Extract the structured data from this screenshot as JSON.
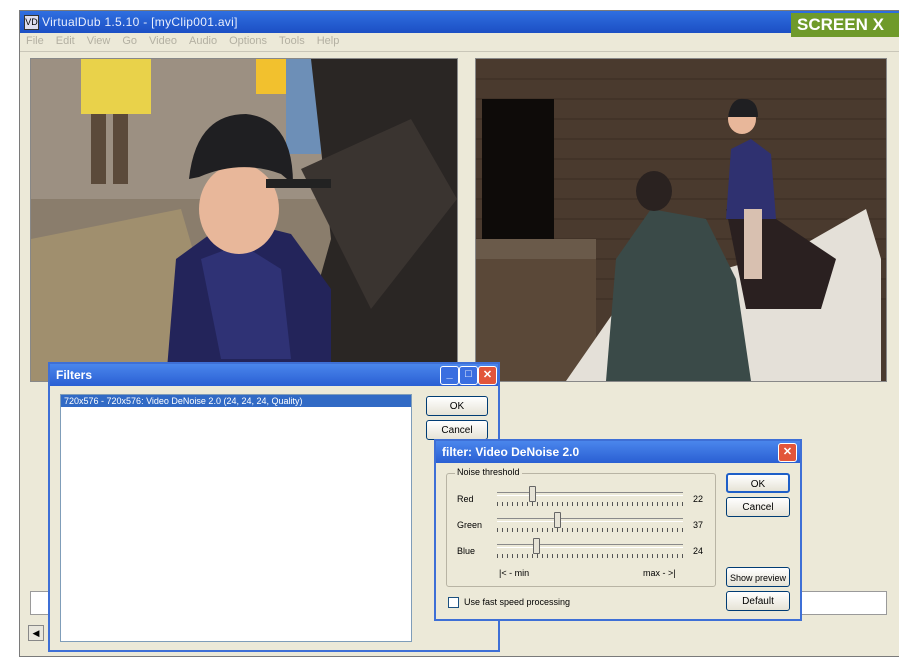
{
  "window": {
    "title": "VirtualDub 1.5.10 - [myClip001.avi]",
    "app_icon": "VD",
    "badge": "SCREEN X"
  },
  "menu": [
    "File",
    "Edit",
    "View",
    "Go",
    "Video",
    "Audio",
    "Options",
    "Tools",
    "Help"
  ],
  "filters_dialog": {
    "title": "Filters",
    "list_items": [
      "720x576 - 720x576: Video DeNoise 2.0 (24, 24, 24, Quality)"
    ],
    "ok_label": "OK",
    "cancel_label": "Cancel"
  },
  "denoise_dialog": {
    "title": "filter: Video DeNoise 2.0",
    "group_label": "Noise threshold",
    "sliders": [
      {
        "label": "Red",
        "value": "22",
        "fraction": 0.19
      },
      {
        "label": "Green",
        "value": "37",
        "fraction": 0.32
      },
      {
        "label": "Blue",
        "value": "24",
        "fraction": 0.21
      }
    ],
    "min_label": "|< - min",
    "max_label": "max - >|",
    "checkbox_label": "Use fast speed processing",
    "checkbox_checked": false,
    "ok_label": "OK",
    "cancel_label": "Cancel",
    "show_preview_label": "Show preview",
    "default_label": "Default"
  }
}
